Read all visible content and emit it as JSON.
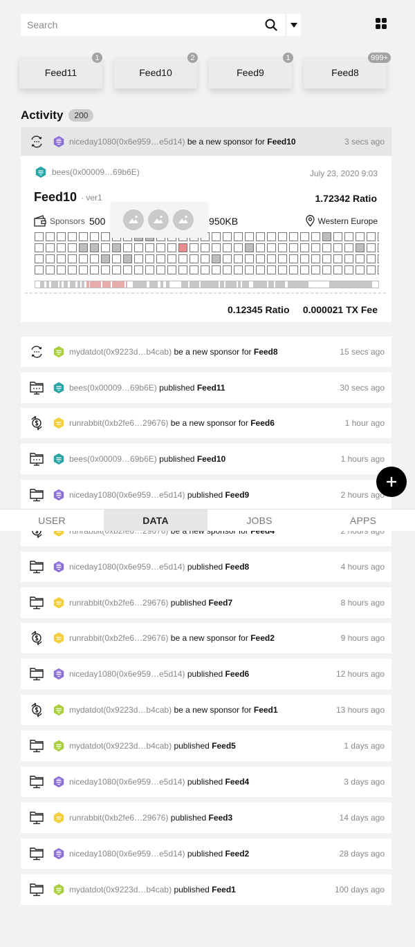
{
  "search": {
    "placeholder": "Search"
  },
  "icons": {
    "search": "search-icon",
    "dropdown": "caret-down-icon",
    "apps": "grid-icon",
    "add": "plus-icon"
  },
  "feeds": [
    {
      "label": "Feed11",
      "count": "1"
    },
    {
      "label": "Feed10",
      "count": "2"
    },
    {
      "label": "Feed9",
      "count": "1"
    },
    {
      "label": "Feed8",
      "count": "999+"
    }
  ],
  "activity": {
    "title": "Activity",
    "count": "200"
  },
  "colors": {
    "purple": "#8b6fd6",
    "teal": "#2aa5a5",
    "yellow": "#f2cf3c",
    "green": "#a9cf3c",
    "red": "#e88e8e",
    "cellfill": "#bdbdbd"
  },
  "rows": [
    {
      "icon": "sponsor-icon",
      "avatar": "purple",
      "user": "niceday1080(0x6e959…e5d14)",
      "action": "be a new sponsor for",
      "feed": "Feed10",
      "time": "3 secs ago"
    },
    {
      "icon": "sponsor-icon",
      "avatar": "green",
      "user": "mydatdot(0x9223d…b4cab)",
      "action": "be a new sponsor for",
      "feed": "Feed8",
      "time": "15 secs ago"
    },
    {
      "icon": "publish-icon",
      "avatar": "teal",
      "user": "bees(0x00009…69b6E)",
      "action": "published",
      "feed": "Feed11",
      "time": "30 secs ago"
    },
    {
      "icon": "coin-icon",
      "avatar": "yellow",
      "user": "runrabbit(0xb2fe6…29676)",
      "action": "be a new sponsor for",
      "feed": "Feed6",
      "time": "1 hour ago"
    },
    {
      "icon": "publish-icon",
      "avatar": "teal",
      "user": "bees(0x00009…69b6E)",
      "action": "published",
      "feed": "Feed10",
      "time": "1 hours ago"
    },
    {
      "icon": "computer-icon",
      "avatar": "purple",
      "user": "niceday1080(0x6e959…e5d14)",
      "action": "published",
      "feed": "Feed9",
      "time": "2 hours ago"
    },
    {
      "icon": "coin-icon",
      "avatar": "yellow",
      "user": "runrabbit(0xb2fe6…29676)",
      "action": "be a new sponsor for",
      "feed": "Feed4",
      "time": "2 hours ago"
    },
    {
      "icon": "computer-icon",
      "avatar": "purple",
      "user": "niceday1080(0x6e959…e5d14)",
      "action": "published",
      "feed": "Feed8",
      "time": "4 hours ago"
    },
    {
      "icon": "computer-icon",
      "avatar": "yellow",
      "user": "runrabbit(0xb2fe6…29676)",
      "action": "published",
      "feed": "Feed7",
      "time": "8 hours ago"
    },
    {
      "icon": "coin-icon",
      "avatar": "yellow",
      "user": "runrabbit(0xb2fe6…29676)",
      "action": "be a new sponsor for",
      "feed": "Feed2",
      "time": "9 hours ago"
    },
    {
      "icon": "computer-icon",
      "avatar": "purple",
      "user": "niceday1080(0x6e959…e5d14)",
      "action": "published",
      "feed": "Feed6",
      "time": "12 hours ago"
    },
    {
      "icon": "coin-icon",
      "avatar": "green",
      "user": "mydatdot(0x9223d…b4cab)",
      "action": "be a new sponsor for",
      "feed": "Feed1",
      "time": "13 hours ago"
    },
    {
      "icon": "computer-icon",
      "avatar": "green",
      "user": "mydatdot(0x9223d…b4cab)",
      "action": "published",
      "feed": "Feed5",
      "time": "1 days ago"
    },
    {
      "icon": "computer-icon",
      "avatar": "purple",
      "user": "niceday1080(0x6e959…e5d14)",
      "action": "published",
      "feed": "Feed4",
      "time": "3 days ago"
    },
    {
      "icon": "computer-icon",
      "avatar": "yellow",
      "user": "runrabbit(0xb2fe6…29676)",
      "action": "published",
      "feed": "Feed3",
      "time": "14 days ago"
    },
    {
      "icon": "computer-icon",
      "avatar": "purple",
      "user": "niceday1080(0x6e959…e5d14)",
      "action": "published",
      "feed": "Feed2",
      "time": "28 days ago"
    },
    {
      "icon": "computer-icon",
      "avatar": "green",
      "user": "mydatdot(0x9223d…b4cab)",
      "action": "published",
      "feed": "Feed1",
      "time": "100 days ago"
    }
  ],
  "detail": {
    "publisher": "bees(0x00009…69b6E)",
    "date": "July 23, 2020 9:03",
    "feed": "Feed10",
    "version": "· ver1",
    "ratio": "1.72342 Ratio",
    "sponsors_label": "Sponsors",
    "sponsors": "500",
    "size": "950KB",
    "region": "Western Europe",
    "footer_ratio": "0.12345 Ratio",
    "footer_fee": "0.000021 TX Fee",
    "block_rows": [
      "0000000001100000000000000010000000000000",
      "0000110100000100000100000000010000000000",
      "0000001010000000100000000000000010000000",
      "0000000000000000000000000000000000000000"
    ],
    "highlight": "1:13"
  },
  "tabs": [
    {
      "label": "USER",
      "active": false
    },
    {
      "label": "DATA",
      "active": true
    },
    {
      "label": "JOBS",
      "active": false
    },
    {
      "label": "APPS",
      "active": false
    }
  ]
}
